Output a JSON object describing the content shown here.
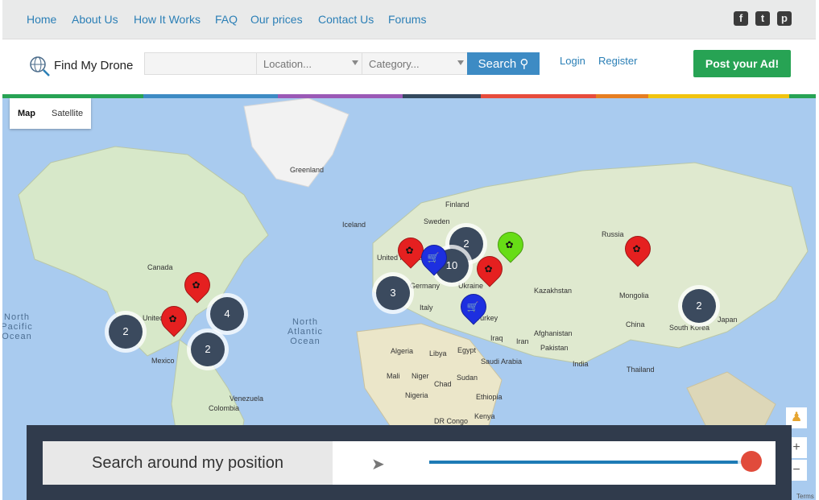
{
  "nav": {
    "items": [
      "Home",
      "About Us",
      "How It Works",
      "FAQ",
      "Our prices",
      "Contact Us",
      "Forums"
    ]
  },
  "social": {
    "facebook": "f",
    "twitter": "t",
    "pinterest": "p"
  },
  "brand": "Find My Drone",
  "search": {
    "location_placeholder": "Location...",
    "category_placeholder": "Category...",
    "button_label": "Search"
  },
  "auth": {
    "login": "Login",
    "register": "Register"
  },
  "post_button": "Post your Ad!",
  "map": {
    "tabs": [
      "Map",
      "Satellite"
    ],
    "labels": [
      "Greenland",
      "Iceland",
      "Canada",
      "Finland",
      "Sweden",
      "Russia",
      "United Kingdom",
      "Germany",
      "Ukraine",
      "Kazakhstan",
      "Mongolia",
      "China",
      "South Korea",
      "Japan",
      "Italy",
      "Turkey",
      "Iraq",
      "Iran",
      "Afghanistan",
      "Pakistan",
      "India",
      "Thailand",
      "Algeria",
      "Libya",
      "Egypt",
      "Saudi Arabia",
      "Mali",
      "Niger",
      "Chad",
      "Sudan",
      "Nigeria",
      "Ethiopia",
      "DR Congo",
      "Kenya",
      "Mexico",
      "Venezuela",
      "Colombia",
      "United States"
    ],
    "oceans": [
      "North Atlantic Ocean",
      "North Pacific Ocean"
    ],
    "clusters": [
      "2",
      "4",
      "2",
      "3",
      "2",
      "10",
      "2"
    ],
    "zoom_in": "+",
    "zoom_out": "−",
    "attribution": "Terms of Use"
  },
  "bottom": {
    "title": "Search around my position",
    "radius_fraction": 1.0
  }
}
